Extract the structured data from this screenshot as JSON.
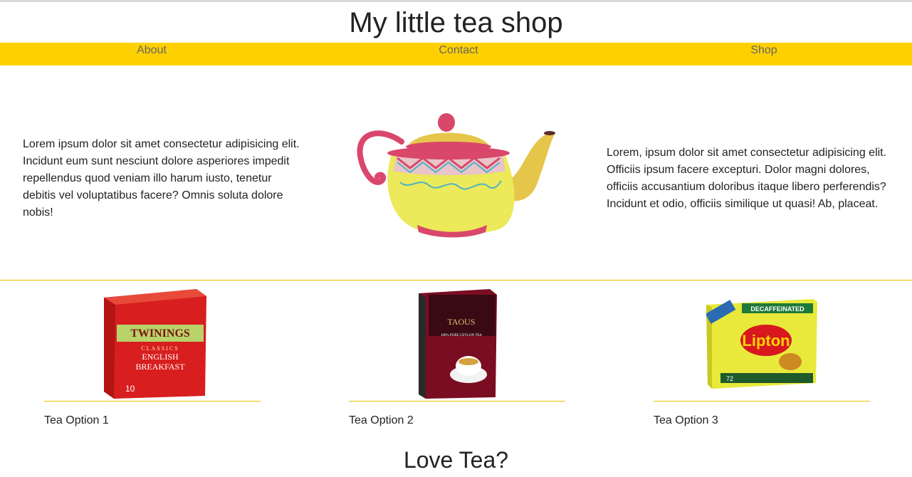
{
  "header": {
    "title": "My little tea shop"
  },
  "nav": {
    "items": [
      {
        "label": "About"
      },
      {
        "label": "Contact"
      },
      {
        "label": "Shop"
      }
    ]
  },
  "hero": {
    "left_text": "Lorem ipsum dolor sit amet consectetur adipisicing elit. Incidunt eum sunt nesciunt dolore asperiores impedit repellendus quod veniam illo harum iusto, tenetur debitis vel voluptatibus facere? Omnis soluta dolore nobis!",
    "right_text": "Lorem, ipsum dolor sit amet consectetur adipisicing elit. Officiis ipsum facere excepturi. Dolor magni dolores, officiis accusantium doloribus itaque libero perferendis? Incidunt et odio, officiis similique ut quasi! Ab, placeat.",
    "image": "teapot-illustration"
  },
  "products": [
    {
      "label": "Tea Option 1",
      "image": "twinings-english-breakfast-box",
      "box_brand": "TWININGS",
      "box_line": "CLASSICS",
      "box_name_1": "ENGLISH",
      "box_name_2": "BREAKFAST",
      "box_count": "10"
    },
    {
      "label": "Tea Option 2",
      "image": "taous-ceylon-tea-box",
      "box_brand": "TAOUS",
      "box_line": "100% PURE CEYLON TEA"
    },
    {
      "label": "Tea Option 3",
      "image": "lipton-decaffeinated-box",
      "box_brand": "Lipton",
      "box_line": "DECAFFEINATED",
      "box_count": "72"
    }
  ],
  "footer": {
    "heading": "Love Tea?"
  },
  "colors": {
    "accent": "#ffd000",
    "rule": "#e6c200",
    "nav_text": "#666666",
    "teapot_body": "#ece95a",
    "teapot_trim": "#d9476b"
  }
}
